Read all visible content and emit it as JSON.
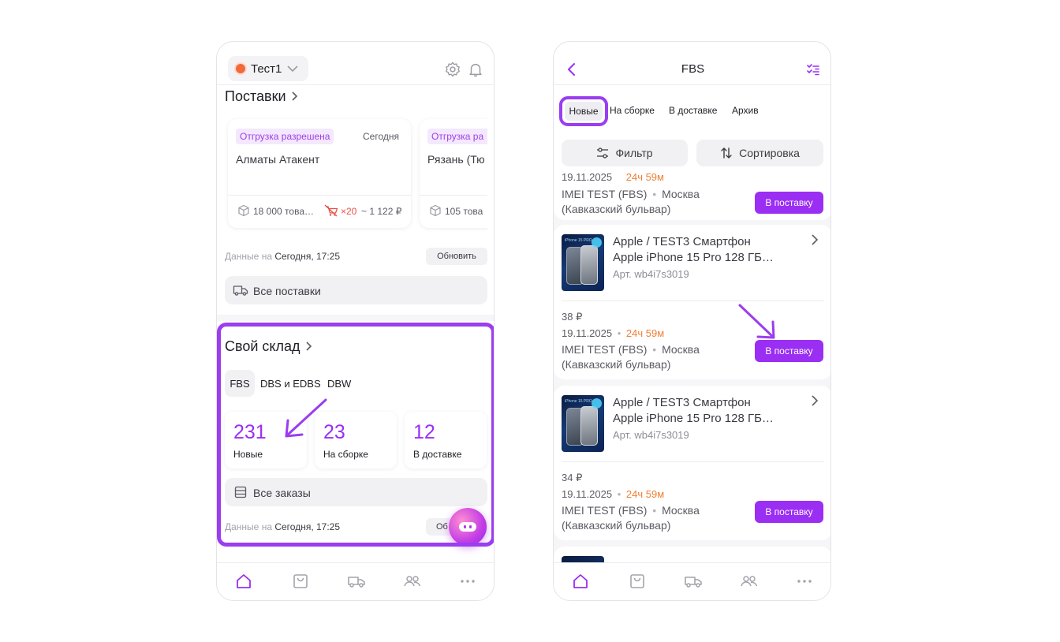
{
  "colors": {
    "accent": "#9b2ef3",
    "accent_dark": "#7d2fd6",
    "tag_bg": "#f3e8fd",
    "tag_text": "#a03fe8",
    "timer": "#f07f33",
    "error": "#e8504a"
  },
  "left": {
    "account": {
      "name": "Тест1",
      "status_color": "#f06a3c"
    },
    "header_icons": [
      "gear-icon",
      "bell-icon"
    ],
    "shipments": {
      "title": "Поставки",
      "cards": [
        {
          "tag": "Отгрузка разрешена",
          "date": "Сегодня",
          "warehouse": "Алматы Атакент",
          "items": "18 000 това…",
          "penalty": "×20",
          "price": "~ 1 122 ₽"
        },
        {
          "tag": "Отгрузка ра",
          "warehouse": "Рязань (Тю",
          "items": "105 това"
        }
      ],
      "updated_label": "Данные на",
      "updated_time": "Сегодня, 17:25",
      "refresh_button": "Обновить",
      "all_button": "Все поставки"
    },
    "own_warehouse": {
      "title": "Свой склад",
      "tabs": [
        "FBS",
        "DBS и EDBS",
        "DBW"
      ],
      "stats": [
        {
          "value": "231",
          "label": "Новые"
        },
        {
          "value": "23",
          "label": "На сборке"
        },
        {
          "value": "12",
          "label": "В доставке"
        }
      ],
      "all_orders_button": "Все заказы",
      "updated_label": "Данные на",
      "updated_time": "Сегодня, 17:25",
      "refresh_button_partial": "Об"
    },
    "bottom_nav": [
      "home-icon",
      "bag-icon",
      "truck-icon",
      "users-icon",
      "more-icon"
    ]
  },
  "right": {
    "header": {
      "title": "FBS"
    },
    "tabs": [
      "Новые",
      "На сборке",
      "В доставке",
      "Архив"
    ],
    "filter_button": "Фильтр",
    "sort_button": "Сортировка",
    "partial_order": {
      "date_partial": "19.11.2025",
      "timer_partial": "24ч 59м",
      "product": "IMEI TEST (FBS)",
      "dot": "•",
      "city": "Москва",
      "address": "(Кавказский бульвар)",
      "button": "В поставку"
    },
    "orders": [
      {
        "title_line1": "Apple / TEST3 Смартфон",
        "title_line2": "Apple iPhone 15 Pro 128 ГБ…",
        "article": "Арт. wb4i7s3019",
        "image_caption": "iPhone 15 PRO",
        "price": "38 ₽",
        "date": "19.11.2025",
        "dot": "•",
        "timer": "24ч 59м",
        "product": "IMEI TEST (FBS)",
        "city": "Москва",
        "address": "(Кавказский бульвар)",
        "button": "В поставку"
      },
      {
        "title_line1": "Apple / TEST3 Смартфон",
        "title_line2": "Apple iPhone 15 Pro 128 ГБ…",
        "article": "Арт. wb4i7s3019",
        "image_caption": "iPhone 15 PRO",
        "price": "34 ₽",
        "date": "19.11.2025",
        "dot": "•",
        "timer": "24ч 59м",
        "product": "IMEI TEST (FBS)",
        "city": "Москва",
        "address": "(Кавказский бульвар)",
        "button": "В поставку"
      }
    ],
    "bottom_nav": [
      "home-icon",
      "bag-icon",
      "truck-icon",
      "users-icon",
      "more-icon"
    ]
  }
}
